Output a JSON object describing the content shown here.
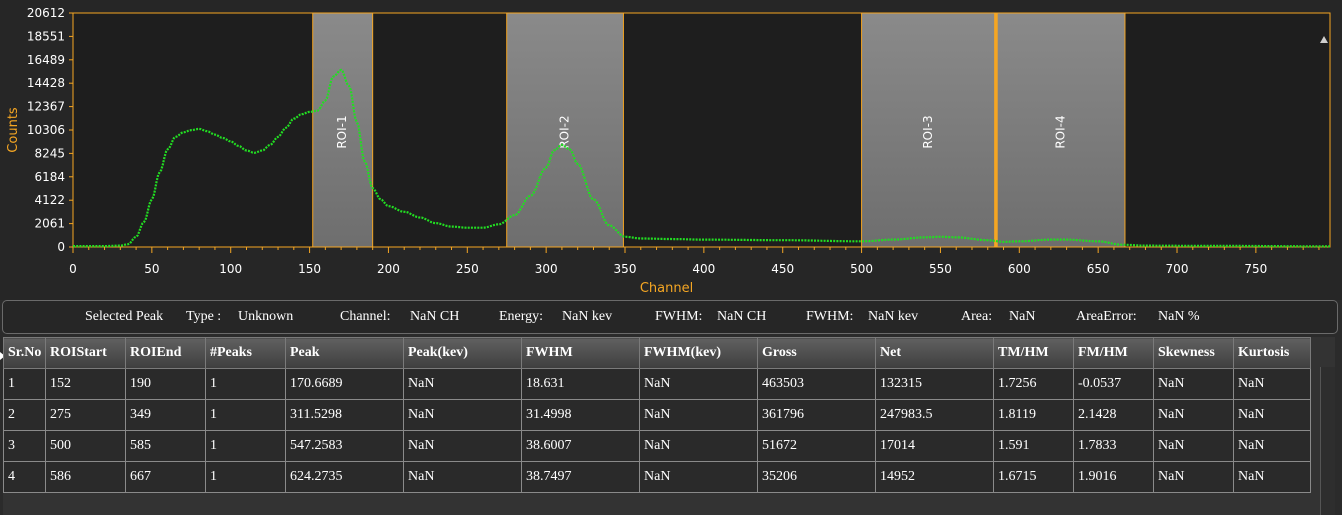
{
  "chart_data": {
    "type": "scatter",
    "xlabel": "Channel",
    "ylabel": "Counts",
    "xlim": [
      0,
      797
    ],
    "ylim": [
      0,
      20612
    ],
    "x_ticks": [
      "0",
      "50",
      "100",
      "150",
      "200",
      "250",
      "300",
      "350",
      "400",
      "450",
      "500",
      "550",
      "600",
      "650",
      "700",
      "750"
    ],
    "y_ticks": [
      "0",
      "2061",
      "4122",
      "6184",
      "8245",
      "10306",
      "12367",
      "14428",
      "16489",
      "18551",
      "20612"
    ],
    "series_color": "#22dd22",
    "roi_regions": [
      {
        "label": "ROI-1",
        "start": 152,
        "end": 190
      },
      {
        "label": "ROI-2",
        "start": 275,
        "end": 349
      },
      {
        "label": "ROI-3",
        "start": 500,
        "end": 585
      },
      {
        "label": "ROI-4",
        "start": 586,
        "end": 667
      }
    ],
    "curve_points": [
      [
        0,
        80
      ],
      [
        20,
        80
      ],
      [
        30,
        120
      ],
      [
        35,
        250
      ],
      [
        40,
        900
      ],
      [
        45,
        2200
      ],
      [
        50,
        4200
      ],
      [
        55,
        6600
      ],
      [
        60,
        8600
      ],
      [
        65,
        9700
      ],
      [
        70,
        10100
      ],
      [
        75,
        10300
      ],
      [
        80,
        10400
      ],
      [
        85,
        10200
      ],
      [
        90,
        9900
      ],
      [
        95,
        9600
      ],
      [
        100,
        9300
      ],
      [
        105,
        8900
      ],
      [
        110,
        8500
      ],
      [
        115,
        8300
      ],
      [
        120,
        8500
      ],
      [
        125,
        9000
      ],
      [
        130,
        9700
      ],
      [
        135,
        10500
      ],
      [
        140,
        11300
      ],
      [
        145,
        11700
      ],
      [
        150,
        11900
      ],
      [
        155,
        12000
      ],
      [
        160,
        12900
      ],
      [
        165,
        15000
      ],
      [
        170,
        15600
      ],
      [
        175,
        14200
      ],
      [
        180,
        11000
      ],
      [
        185,
        7500
      ],
      [
        190,
        5200
      ],
      [
        195,
        4200
      ],
      [
        200,
        3600
      ],
      [
        210,
        3100
      ],
      [
        220,
        2600
      ],
      [
        230,
        2100
      ],
      [
        240,
        1800
      ],
      [
        250,
        1700
      ],
      [
        260,
        1700
      ],
      [
        270,
        2000
      ],
      [
        280,
        2800
      ],
      [
        290,
        4500
      ],
      [
        300,
        7000
      ],
      [
        305,
        8500
      ],
      [
        310,
        9000
      ],
      [
        315,
        8600
      ],
      [
        320,
        7300
      ],
      [
        330,
        4200
      ],
      [
        340,
        1900
      ],
      [
        350,
        900
      ],
      [
        360,
        750
      ],
      [
        380,
        700
      ],
      [
        400,
        650
      ],
      [
        450,
        600
      ],
      [
        500,
        500
      ],
      [
        520,
        650
      ],
      [
        540,
        850
      ],
      [
        550,
        900
      ],
      [
        560,
        850
      ],
      [
        580,
        600
      ],
      [
        590,
        450
      ],
      [
        600,
        500
      ],
      [
        620,
        650
      ],
      [
        630,
        650
      ],
      [
        650,
        500
      ],
      [
        665,
        200
      ],
      [
        680,
        120
      ],
      [
        720,
        100
      ],
      [
        797,
        60
      ]
    ]
  },
  "info_bar": {
    "selected_peak": "Selected Peak",
    "type_label": "Type :",
    "type_value": "Unknown",
    "channel_label": "Channel:",
    "channel_value": "NaN CH",
    "energy_label": "Energy:",
    "energy_value": "NaN kev",
    "fwhm_ch_label": "FWHM:",
    "fwhm_ch_value": "NaN CH",
    "fwhm_kev_label": "FWHM:",
    "fwhm_kev_value": "NaN kev",
    "area_label": "Area:",
    "area_value": "NaN",
    "area_error_label": "AreaError:",
    "area_error_value": "NaN %"
  },
  "table": {
    "columns": [
      "Sr.No",
      "ROIStart",
      "ROIEnd",
      "#Peaks",
      "Peak",
      "Peak(kev)",
      "FWHM",
      "FWHM(kev)",
      "Gross",
      "Net",
      "TM/HM",
      "FM/HM",
      "Skewness",
      "Kurtosis"
    ],
    "rows": [
      [
        "1",
        "152",
        "190",
        "1",
        "170.6689",
        "NaN",
        "18.631",
        "NaN",
        "463503",
        "132315",
        "1.7256",
        "-0.0537",
        "NaN",
        "NaN"
      ],
      [
        "2",
        "275",
        "349",
        "1",
        "311.5298",
        "NaN",
        "31.4998",
        "NaN",
        "361796",
        "247983.5",
        "1.8119",
        "2.1428",
        "NaN",
        "NaN"
      ],
      [
        "3",
        "500",
        "585",
        "1",
        "547.2583",
        "NaN",
        "38.6007",
        "NaN",
        "51672",
        "17014",
        "1.591",
        "1.7833",
        "NaN",
        "NaN"
      ],
      [
        "4",
        "586",
        "667",
        "1",
        "624.2735",
        "NaN",
        "38.7497",
        "NaN",
        "35206",
        "14952",
        "1.6715",
        "1.9016",
        "NaN",
        "NaN"
      ]
    ]
  }
}
